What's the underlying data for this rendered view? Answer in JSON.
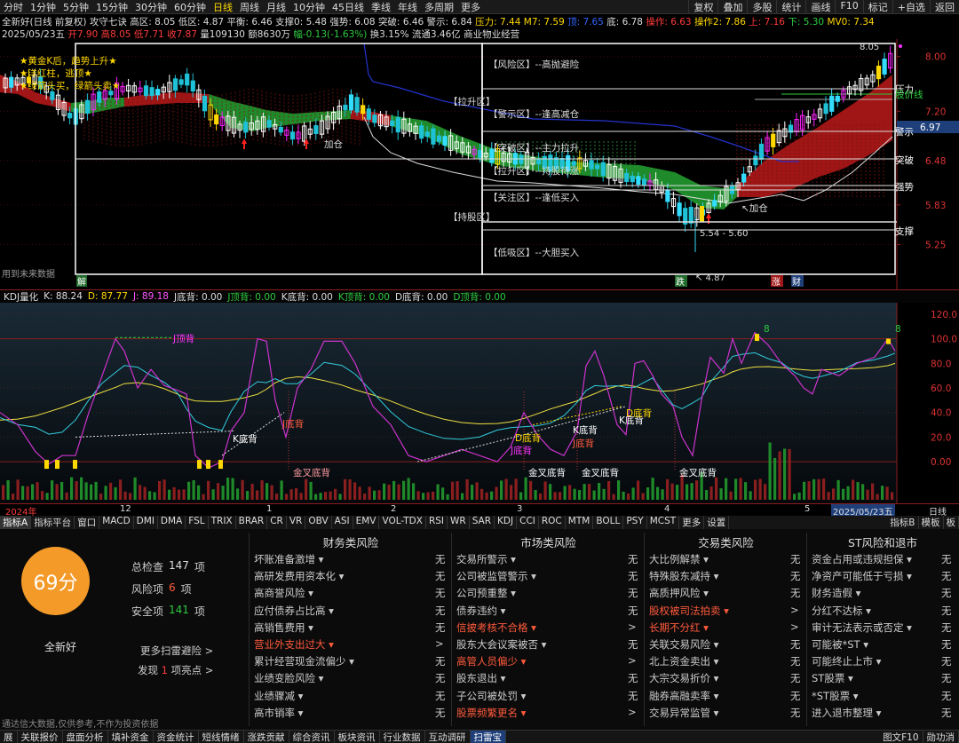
{
  "topbar": {
    "items": [
      "分时",
      "1分钟",
      "5分钟",
      "15分钟",
      "30分钟",
      "60分钟",
      "日线",
      "周线",
      "月线",
      "10分钟",
      "45日线",
      "季线",
      "年线",
      "多周期",
      "更多"
    ],
    "selected": "日线",
    "right": [
      "复权",
      "叠加",
      "多股",
      "统计",
      "画线",
      "F10",
      "标记",
      "+自选",
      "返回"
    ]
  },
  "info1": {
    "name": "全新好(日线 前复权)",
    "ind": "攻守七诀",
    "gaoqu": "高区: 8.05",
    "diqu": "低区: 4.87",
    "pingheng": "平衡: 6.46",
    "zhicheng": "支撑0: 5.48",
    "qiangshi": "强势: 6.08",
    "tupo": "突破: 6.46",
    "jingshi": "警示: 6.84",
    "yali": "压力: 7.44",
    "m7": "M7: 7.59",
    "ding": "顶: 7.65",
    "di": "底: 6.78",
    "caozuo": "操作: 6.63",
    "caozuo2": "操作2: 7.86",
    "shang": "上: 7.16",
    "xia": "下: 5.30",
    "mv": "MV0: 7.34"
  },
  "info2": {
    "date": "2025/05/23五",
    "open": "开7.90",
    "high": "高8.05",
    "low": "低7.71",
    "close": "收7.87",
    "vol": "量109130",
    "amt": "额8630万",
    "chg": "幅-0.13(-1.63%)",
    "turn": "换3.15%",
    "float": "流通3.46亿",
    "sector": "商业物业经营"
  },
  "main": {
    "price_axis": [
      "8.00",
      "7.20",
      "6.48",
      "5.83",
      "5.25"
    ],
    "current_price": "6.97",
    "legend": [
      "★黄金K后，趋势上升★",
      "★洋红柱，逃顶★",
      "★绿箭头买，绿箭头卖★"
    ],
    "zones": [
      "【风险区】--高抛避险",
      "【拉升区】",
      "【警示区】--逢高减仓",
      "【突破区】--主力拉升",
      "【拉升区】--持股待涨",
      "【关注区】--逢低买入",
      "【持股区】",
      "【低吸区】--大胆买入"
    ],
    "right_labels": [
      "压力",
      "股价线",
      "警示",
      "突破",
      "强势",
      "支撑"
    ],
    "annotations": {
      "high_price": "8.05",
      "low_price": "4.87",
      "range": "5.54 - 5.60",
      "jiacang1": "加仓",
      "jiacang2": "加仓",
      "jie": "解",
      "die": "跌",
      "zhang": "涨",
      "cai": "财",
      "future": "用到未来数据"
    }
  },
  "kdj": {
    "header": {
      "name": "KDJ量化",
      "k": "K: 88.24",
      "d": "D: 87.77",
      "j": "J: 89.18",
      "jdb": "J底背: 0.00",
      "jdg": "J顶背: 0.00",
      "kdb": "K底背: 0.00",
      "kdg": "K顶背: 0.00",
      "ddb": "D底背: 0.00",
      "ddg": "D顶背: 0.00"
    },
    "axis": [
      "120.0",
      "100.0",
      "80.0",
      "60.0",
      "40.0",
      "20.0",
      "0.00"
    ],
    "labels": {
      "jdingbei": "J顶背",
      "kdibei1": "K底背",
      "jdibei1": "J底背",
      "jinchadibei1": "金叉底背",
      "ddibei": "D底背",
      "jdibei2": "J底背",
      "jdibei3": "J底背",
      "kdibei2": "K底背",
      "jinchadibei2": "金叉底背",
      "jinchadibei3": "金叉底背",
      "kdibei3": "K底背",
      "ddibei2": "D底背",
      "jinchadibei4": "金叉底背",
      "eight1": "8",
      "eight2": "8"
    }
  },
  "timeaxis": {
    "labels": [
      "2024年",
      "12",
      "1",
      "2",
      "3",
      "4",
      "5"
    ],
    "current": "2025/05/23五",
    "right": "日线"
  },
  "tabs": [
    "指标A",
    "指标平台",
    "窗口",
    "MACD",
    "DMI",
    "DMA",
    "FSL",
    "TRIX",
    "BRAR",
    "CR",
    "VR",
    "OBV",
    "ASI",
    "EMV",
    "VOL-TDX",
    "RSI",
    "WR",
    "SAR",
    "KDJ",
    "CCI",
    "ROC",
    "MTM",
    "BOLL",
    "PSY",
    "MCST",
    "更多",
    "设置"
  ],
  "tabs_right": [
    "指标B",
    "模板",
    "板"
  ],
  "panel": {
    "score": "69分",
    "stock": "全新好",
    "summary": [
      {
        "label": "总检查",
        "value": "147",
        "unit": "项"
      },
      {
        "label": "风险项",
        "value": "6",
        "unit": "项"
      },
      {
        "label": "安全项",
        "value": "141",
        "unit": "项"
      }
    ],
    "more_link": "更多扫雷避险 >",
    "find_pre": "发现",
    "find_num": "1",
    "find_post": "项亮点 >",
    "disclaimer": "通达信大数据,仅供参考,不作为投资依据",
    "columns": [
      {
        "title": "财务类风险",
        "rows": [
          {
            "name": "坏账准备激增",
            "v": "无",
            "hl": false
          },
          {
            "name": "高研发费用资本化",
            "v": "无",
            "hl": false
          },
          {
            "name": "高商誉风险",
            "v": "无",
            "hl": false
          },
          {
            "name": "应付债券占比高",
            "v": "无",
            "hl": false
          },
          {
            "name": "高销售费用",
            "v": "无",
            "hl": false
          },
          {
            "name": "营业外支出过大",
            "v": ">",
            "hl": true
          },
          {
            "name": "累计经营现金流偏少",
            "v": "无",
            "hl": false
          },
          {
            "name": "业绩变脸风险",
            "v": "无",
            "hl": false
          },
          {
            "name": "业绩骤减",
            "v": "无",
            "hl": false
          },
          {
            "name": "高市销率",
            "v": "无",
            "hl": false
          }
        ]
      },
      {
        "title": "市场类风险",
        "rows": [
          {
            "name": "交易所警示",
            "v": "无",
            "hl": false
          },
          {
            "name": "公司被监管警示",
            "v": "无",
            "hl": false
          },
          {
            "name": "公司预重整",
            "v": "无",
            "hl": false
          },
          {
            "name": "债券违约",
            "v": "无",
            "hl": false
          },
          {
            "name": "信披考核不合格",
            "v": ">",
            "hl": true
          },
          {
            "name": "股东大会议案被否",
            "v": "无",
            "hl": false
          },
          {
            "name": "高管人员偏少",
            "v": ">",
            "hl": true
          },
          {
            "name": "股东退出",
            "v": "无",
            "hl": false
          },
          {
            "name": "子公司被处罚",
            "v": "无",
            "hl": false
          },
          {
            "name": "股票频繁更名",
            "v": ">",
            "hl": true
          }
        ]
      },
      {
        "title": "交易类风险",
        "rows": [
          {
            "name": "大比例解禁",
            "v": "无",
            "hl": false
          },
          {
            "name": "特殊股东减持",
            "v": "无",
            "hl": false
          },
          {
            "name": "高质押风险",
            "v": "无",
            "hl": false
          },
          {
            "name": "股权被司法拍卖",
            "v": ">",
            "hl": true
          },
          {
            "name": "长期不分红",
            "v": ">",
            "hl": true
          },
          {
            "name": "关联交易风险",
            "v": "无",
            "hl": false
          },
          {
            "name": "北上资金卖出",
            "v": "无",
            "hl": false
          },
          {
            "name": "大宗交易折价",
            "v": "无",
            "hl": false
          },
          {
            "name": "融券高融卖率",
            "v": "无",
            "hl": false
          },
          {
            "name": "交易异常监管",
            "v": "无",
            "hl": false
          }
        ]
      },
      {
        "title": "ST风险和退市",
        "rows": [
          {
            "name": "资金占用或违规担保",
            "v": "无",
            "hl": false
          },
          {
            "name": "净资产可能低于亏损",
            "v": "无",
            "hl": false
          },
          {
            "name": "财务造假",
            "v": "无",
            "hl": false
          },
          {
            "name": "分红不达标",
            "v": "无",
            "hl": false
          },
          {
            "name": "审计无法表示或否定",
            "v": "无",
            "hl": false
          },
          {
            "name": "可能被*ST",
            "v": "无",
            "hl": false
          },
          {
            "name": "可能终止上市",
            "v": "无",
            "hl": false
          },
          {
            "name": "ST股票",
            "v": "无",
            "hl": false
          },
          {
            "name": "*ST股票",
            "v": "无",
            "hl": false
          },
          {
            "name": "进入退市整理",
            "v": "无",
            "hl": false
          }
        ]
      }
    ]
  },
  "bottombar": [
    "展",
    "关联报价",
    "盘面分析",
    "填补资金",
    "资金统计",
    "短线情绪",
    "涨跌贡献",
    "综合资讯",
    "板块资讯",
    "行业数据",
    "互动调研",
    "扫雷宝"
  ],
  "bottom_selected": "扫雷宝",
  "bottom_right": [
    "图文F10",
    "勋功消"
  ]
}
